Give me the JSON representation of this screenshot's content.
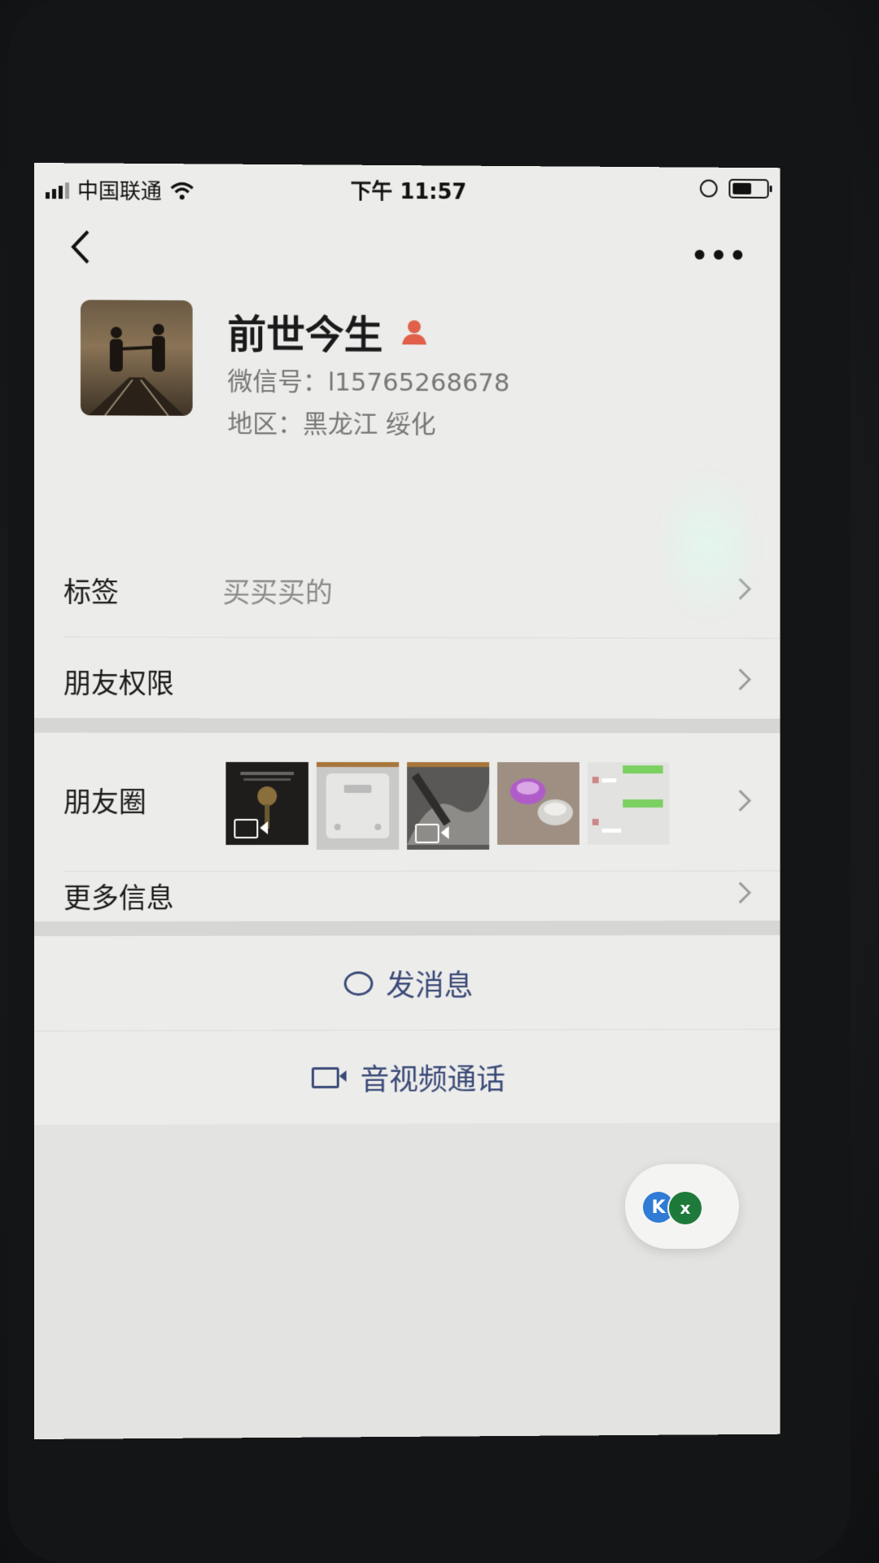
{
  "status_bar": {
    "carrier": "中国联通",
    "time": "下午 11:57",
    "battery_level": 0.6
  },
  "nav": {
    "back_icon": "chevron-left-icon",
    "more_label": "•••"
  },
  "profile": {
    "name": "前世今生",
    "gender_icon": "person-icon",
    "gender_color": "#e0604a",
    "wechat_id": "微信号：l15765268678",
    "region": "地区：黑龙江 绥化"
  },
  "rows": {
    "tags_label": "标签",
    "tags_value": "买买买的",
    "permissions_label": "朋友权限",
    "moments_label": "朋友圈",
    "more_info_label": "更多信息"
  },
  "moments_thumbs": [
    {
      "kind": "video",
      "icon": "video-icon"
    },
    {
      "kind": "image"
    },
    {
      "kind": "video",
      "icon": "video-icon"
    },
    {
      "kind": "image"
    },
    {
      "kind": "image"
    }
  ],
  "actions": {
    "message_label": "发消息",
    "call_label": "音视频通话"
  },
  "floating_widget": {
    "left_badge": "K",
    "right_badge": "x"
  },
  "colors": {
    "action_blue": "#3a4a78",
    "screen_bg": "#ececea",
    "gap_bg": "#d6d6d4"
  }
}
